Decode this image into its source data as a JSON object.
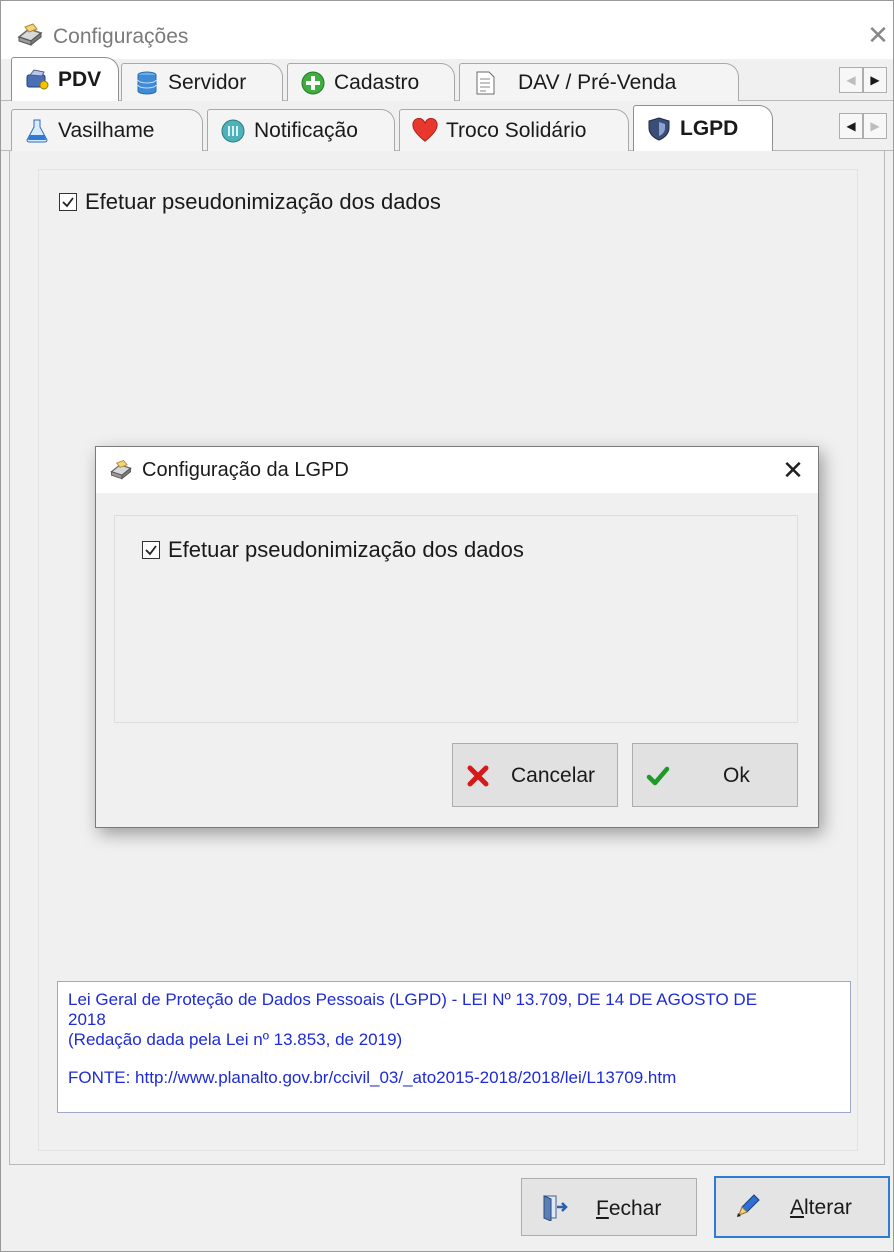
{
  "window": {
    "title": "Configurações",
    "close_glyph": "✕",
    "icon": "printer-icon"
  },
  "tabs_row1": [
    {
      "label": "PDV",
      "icon": "pdv-icon",
      "active": true
    },
    {
      "label": "Servidor",
      "icon": "database-icon",
      "active": false
    },
    {
      "label": "Cadastro",
      "icon": "plus-circle-icon",
      "active": false
    },
    {
      "label": "DAV / Pré-Venda",
      "icon": "document-icon",
      "active": false
    }
  ],
  "tabs_row2": [
    {
      "label": "Vasilhame",
      "icon": "flask-icon",
      "active": false
    },
    {
      "label": "Notificação",
      "icon": "notification-icon",
      "active": false
    },
    {
      "label": "Troco Solidário",
      "icon": "heart-icon",
      "active": false
    },
    {
      "label": "LGPD",
      "icon": "shield-icon",
      "active": true
    }
  ],
  "lgpd": {
    "checkbox_label": "Efetuar pseudonimização dos dados",
    "checked": true,
    "info_lines": [
      "Lei Geral de Proteção de Dados Pessoais (LGPD) - LEI Nº 13.709, DE 14 DE AGOSTO DE",
      "2018",
      "(Redação dada pela Lei nº 13.853, de 2019)",
      "FONTE: http://www.planalto.gov.br/ccivil_03/_ato2015-2018/2018/lei/L13709.htm"
    ]
  },
  "buttons": {
    "fechar": {
      "label_prefix": "F",
      "label_rest": "echar"
    },
    "alterar": {
      "label_prefix": "A",
      "label_rest": "lterar"
    }
  },
  "dialog": {
    "title": "Configuração da LGPD",
    "close_glyph": "✕",
    "checkbox_label": "Efetuar pseudonimização dos dados",
    "checked": true,
    "cancel_label": "Cancelar",
    "ok_label": "Ok"
  },
  "colors": {
    "info_text": "#1e2bd6",
    "primary_button_border": "#2e7bd6",
    "cancel_icon": "#d61a1a",
    "ok_icon": "#1f9a2a"
  }
}
